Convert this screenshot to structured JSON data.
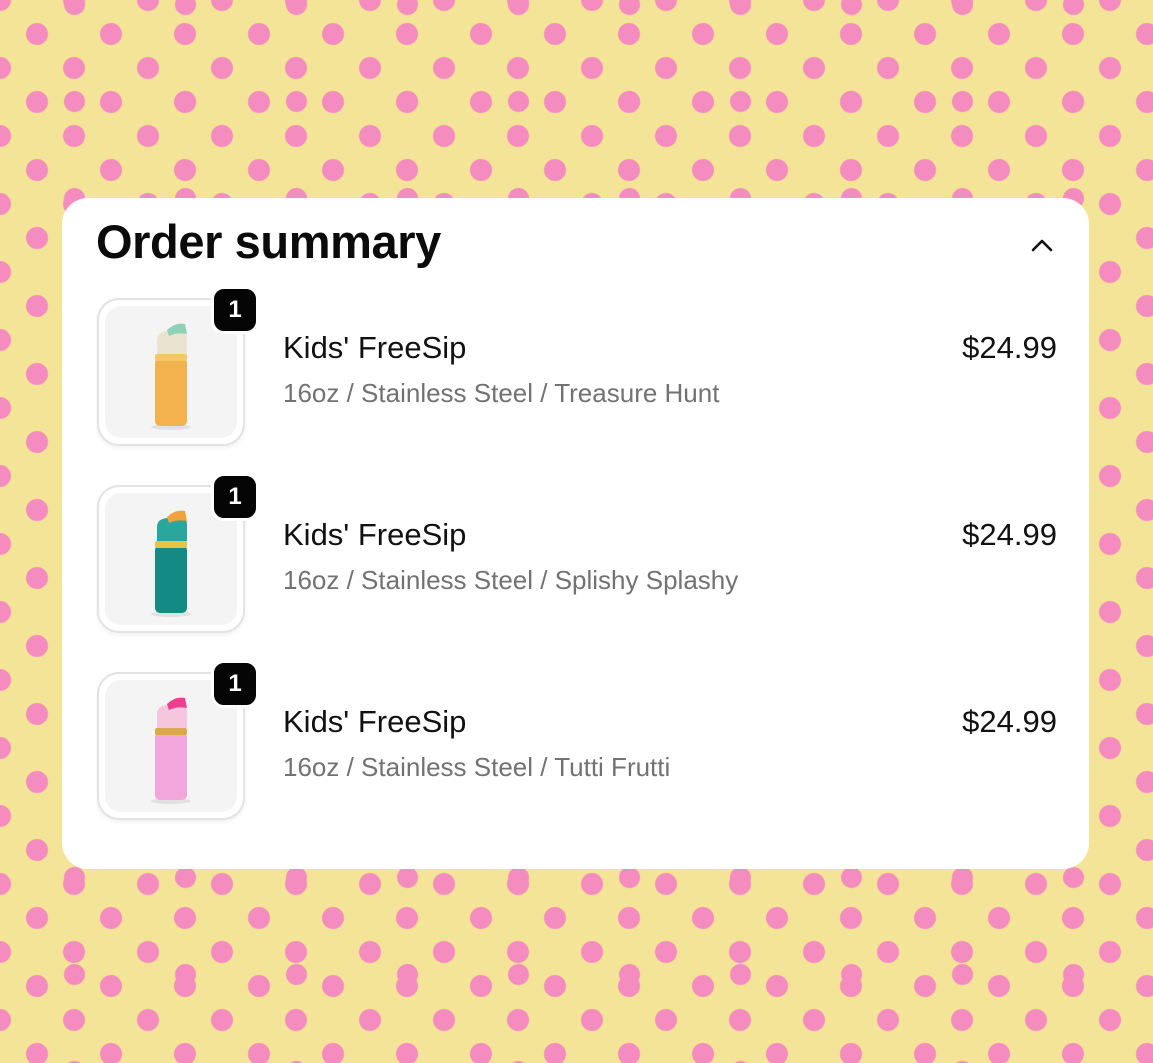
{
  "order_summary": {
    "title": "Order summary",
    "toggle_icon": "chevron-up-icon",
    "items": [
      {
        "quantity": "1",
        "name": "Kids' FreeSip",
        "variant": "16oz / Stainless Steel / Treasure Hunt",
        "price": "$24.99",
        "product_colors": {
          "body": "#f3b24d",
          "band": "#f6c66c",
          "lid": "#e9e3cf",
          "spout": "#8fd1b8"
        }
      },
      {
        "quantity": "1",
        "name": "Kids' FreeSip",
        "variant": "16oz / Stainless Steel / Splishy Splashy",
        "price": "$24.99",
        "product_colors": {
          "body": "#138a83",
          "band": "#e5c44a",
          "lid": "#2aa79c",
          "spout": "#f0a33c"
        }
      },
      {
        "quantity": "1",
        "name": "Kids' FreeSip",
        "variant": "16oz / Stainless Steel / Tutti Frutti",
        "price": "$24.99",
        "product_colors": {
          "body": "#f3a6dc",
          "band": "#d9a94a",
          "lid": "#f6c6de",
          "spout": "#ee3f8e"
        }
      }
    ]
  },
  "colors": {
    "background": "#f3e497",
    "dots": "#f48cbf",
    "card": "#ffffff",
    "badge": "#050505"
  }
}
